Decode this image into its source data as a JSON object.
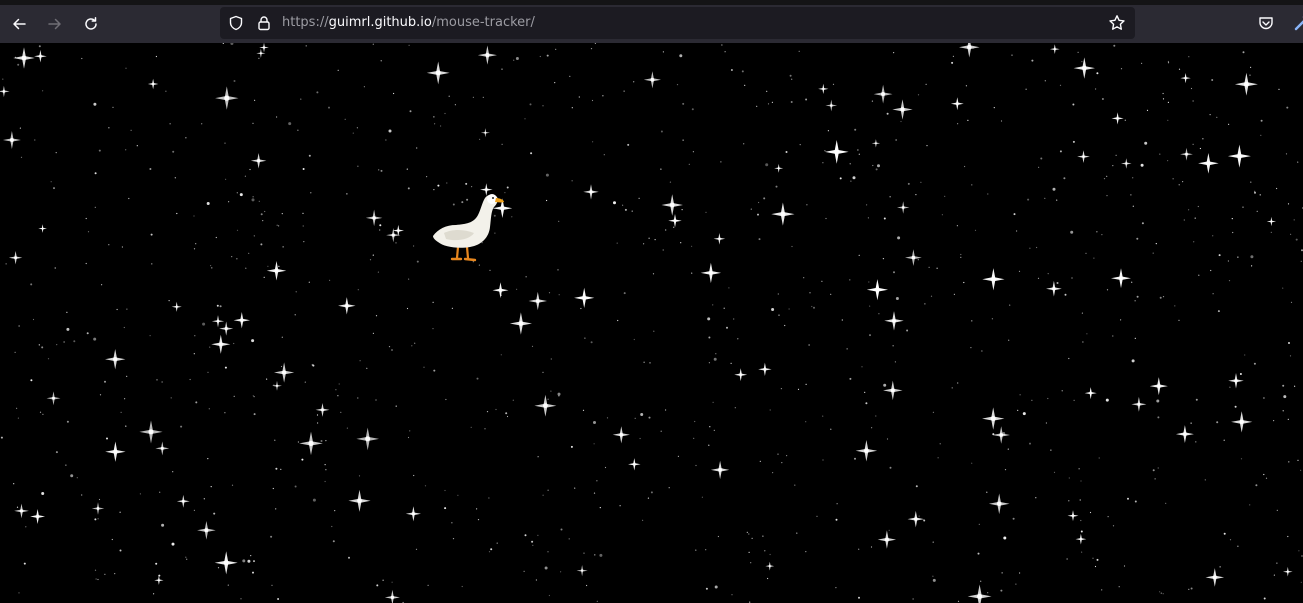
{
  "browser": {
    "url": {
      "scheme": "https://",
      "host": "guimrl.github.io",
      "path": "/mouse-tracker/"
    },
    "icons": {
      "back": "arrow-left-icon",
      "forward": "arrow-right-icon",
      "reload": "reload-icon",
      "tracking_protection": "shield-icon",
      "lock": "lock-icon",
      "bookmark": "star-icon",
      "pocket": "pocket-icon",
      "extension": "extension-icon"
    },
    "colors": {
      "toolbar": "#2b2a33",
      "urlbar": "#1c1b22",
      "text": "#fbfbfe",
      "muted": "#9c9ca3"
    }
  },
  "page": {
    "background": "#000000",
    "sprite": "duck-icon",
    "star_color": "#ffffff"
  }
}
